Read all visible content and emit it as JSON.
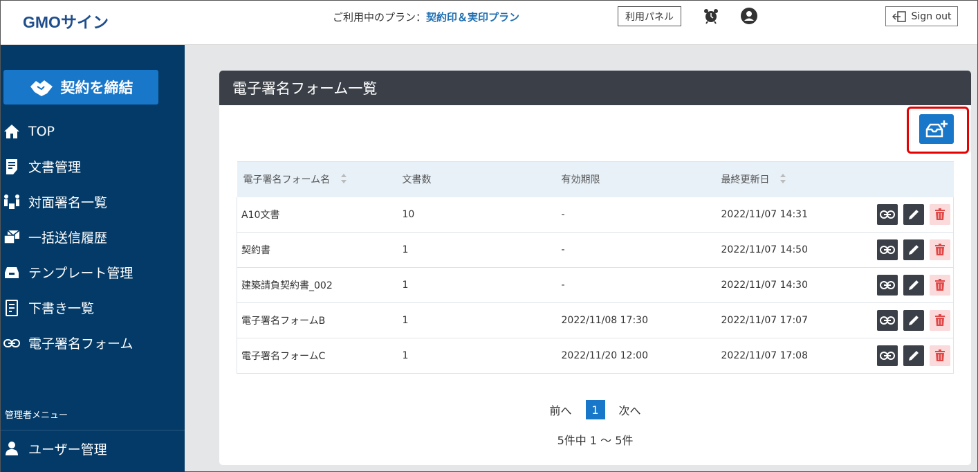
{
  "header": {
    "logo": "GMOサイン",
    "plan_label": "ご利用中のプラン：",
    "plan_name": "契約印＆実印プラン",
    "panel_button": "利用パネル",
    "signout": "Sign out"
  },
  "sidebar": {
    "contract_button": "契約を締結",
    "items": [
      {
        "label": "TOP",
        "icon": "home-icon"
      },
      {
        "label": "文書管理",
        "icon": "document-icon"
      },
      {
        "label": "対面署名一覧",
        "icon": "face-to-face-icon"
      },
      {
        "label": "一括送信履歴",
        "icon": "bulk-send-icon"
      },
      {
        "label": "テンプレート管理",
        "icon": "template-icon"
      },
      {
        "label": "下書き一覧",
        "icon": "draft-icon"
      },
      {
        "label": "電子署名フォーム",
        "icon": "link-icon"
      }
    ],
    "admin_label": "管理者メニュー",
    "admin_items": [
      {
        "label": "ユーザー管理",
        "icon": "user-icon"
      }
    ]
  },
  "main": {
    "title": "電子署名フォーム一覧",
    "table": {
      "columns": [
        "電子署名フォーム名",
        "文書数",
        "有効期限",
        "最終更新日"
      ],
      "rows": [
        {
          "name": "A10文書",
          "count": "10",
          "expiry": "-",
          "updated": "2022/11/07 14:31"
        },
        {
          "name": "契約書",
          "count": "1",
          "expiry": "-",
          "updated": "2022/11/07 14:50"
        },
        {
          "name": "建築請負契約書_002",
          "count": "1",
          "expiry": "-",
          "updated": "2022/11/07 14:30"
        },
        {
          "name": "電子署名フォームB",
          "count": "1",
          "expiry": "2022/11/08 17:30",
          "updated": "2022/11/07 17:07"
        },
        {
          "name": "電子署名フォームC",
          "count": "1",
          "expiry": "2022/11/20 12:00",
          "updated": "2022/11/07 17:08"
        }
      ]
    },
    "pager": {
      "prev": "前へ",
      "current": "1",
      "next": "次へ"
    },
    "count_text": "5件中 1 ～ 5件"
  },
  "colors": {
    "sidebar_bg": "#033a67",
    "accent": "#1877c9",
    "card_header": "#3b4048",
    "highlight": "#e60000"
  }
}
